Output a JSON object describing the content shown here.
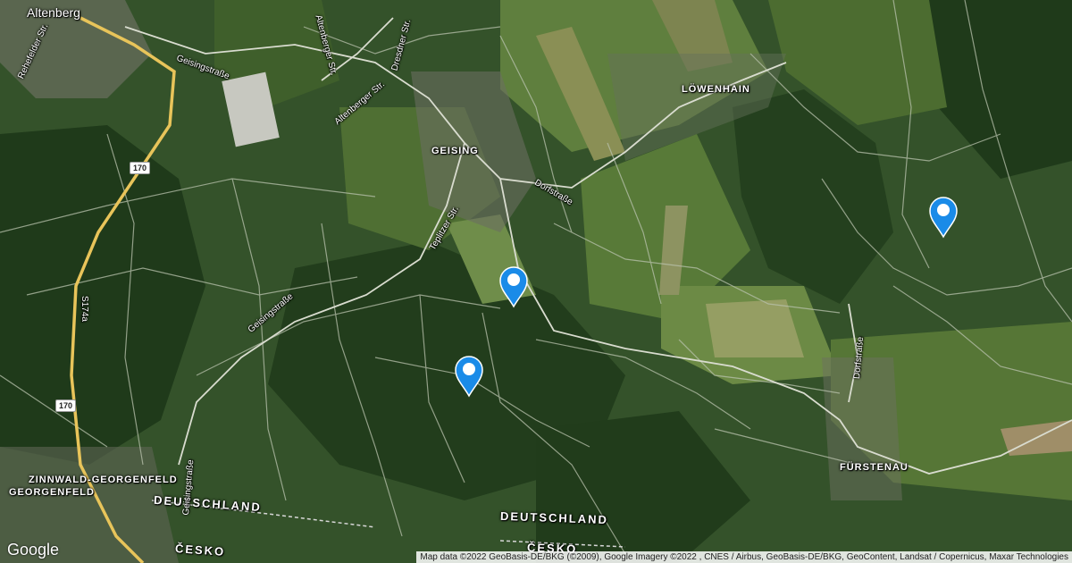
{
  "labels": {
    "altenberg": "Altenberg",
    "geising": "GEISING",
    "loewenhain": "LÖWENHAIN",
    "fuerstenau": "FÜRSTENAU",
    "zinnwald": "ZINNWALD-GEORGENFELD",
    "georgenfeld": "GEORGENFELD",
    "deutschland_1": "DEUTSCHLAND",
    "deutschland_2": "DEUTSCHLAND",
    "cesko_1": "ČESKO",
    "cesko_2": "ČESKO",
    "rehefelder": "Rehefelder Str.",
    "geisingstrasse_1": "Geisingstraße",
    "geisingstrasse_2": "Geisingstraße",
    "geisingstrasse_3": "Geisingstraße",
    "altenberger_1": "Altenberger Str.",
    "altenberger_2": "Altenberger Str.",
    "dresdner": "Dresdner Str.",
    "dorfstrasse_1": "Dorfstraße",
    "dorfstrasse_2": "Dorfstraße",
    "teplitzer": "Teplitzer Str.",
    "s174a": "S174a"
  },
  "shields": {
    "b170_top": "170",
    "b170_bottom": "170"
  },
  "markers": [
    {
      "name": "marker-1"
    },
    {
      "name": "marker-2"
    },
    {
      "name": "marker-3"
    }
  ],
  "google_logo": "Google",
  "attribution": "Map data ©2022 GeoBasis-DE/BKG (©2009), Google Imagery ©2022 , CNES / Airbus, GeoBasis-DE/BKG, GeoContent, Landsat / Copernicus, Maxar Technologies",
  "colors": {
    "marker": "#1a8be8",
    "road_major": "#e8c45a",
    "road_minor": "#c8cfc0"
  }
}
